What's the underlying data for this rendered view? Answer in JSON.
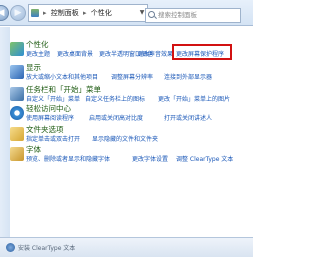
{
  "addressbar": {
    "path": [
      "控制面板",
      "个性化"
    ],
    "search_placeholder": "搜索控制面板",
    "nav_back": "◀",
    "nav_fwd": "▶",
    "dropdown": "▼",
    "refresh": "↻"
  },
  "categories": [
    {
      "title": "个性化",
      "links": [
        "更改主题",
        "更改桌面背景",
        "更改半透明窗口颜色",
        "更改声音效果",
        "更改屏幕保护程序"
      ]
    },
    {
      "title": "显示",
      "links": [
        "放大或缩小文本和其他项目",
        "调整屏幕分辨率",
        "连接到外部显示器"
      ]
    },
    {
      "title": "任务栏和「开始」菜单",
      "links": [
        "自定义「开始」菜单",
        "自定义任务栏上的图标",
        "更改「开始」菜单上的图片"
      ]
    },
    {
      "title": "轻松访问中心",
      "links": [
        "使用屏幕阅读程序",
        "启用或关闭高对比度",
        "打开或关闭讲述人"
      ]
    },
    {
      "title": "文件夹选项",
      "links": [
        "指定单击或双击打开",
        "显示隐藏的文件和文件夹"
      ]
    },
    {
      "title": "字体",
      "links": [
        "预览、删除或者显示和隐藏字体",
        "更改字体设置",
        "调整 ClearType 文本"
      ]
    }
  ],
  "statusbar": {
    "text": "安装 ClearType 文本"
  },
  "colors": {
    "highlight": "#d21111",
    "link": "#1b58b8",
    "category_title": "#1e5b12"
  }
}
